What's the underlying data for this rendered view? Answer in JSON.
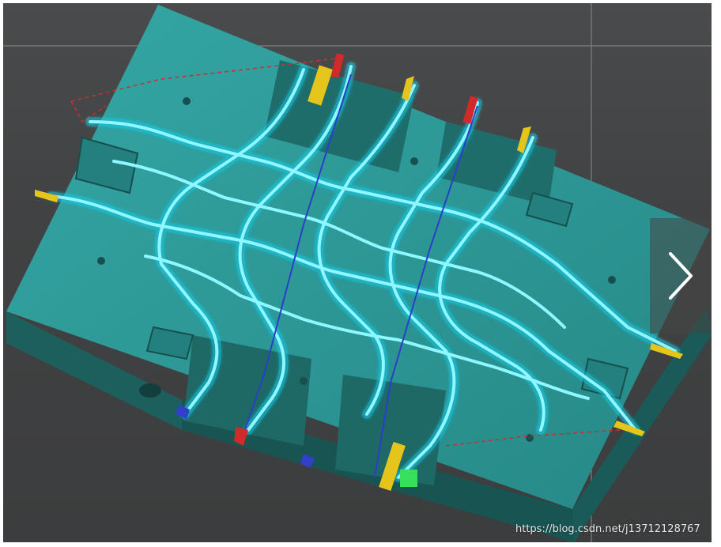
{
  "scene": {
    "subject": "mold-plate-cooling-channels",
    "colors": {
      "background": "#434445",
      "plate_top": "#2f9c9a",
      "plate_side": "#1f6a68",
      "plate_dark": "#185452",
      "channel_glow": "#1fd8f0",
      "channel_core": "#7ff6ff",
      "inlet_yellow": "#e5c51c",
      "inlet_red": "#d02a2a",
      "inlet_green": "#36e05a",
      "inlet_blue": "#3040c8"
    }
  },
  "navigation": {
    "next_icon": "chevron-right-icon"
  },
  "watermark": {
    "text": "https://blog.csdn.net/j13712128767"
  }
}
